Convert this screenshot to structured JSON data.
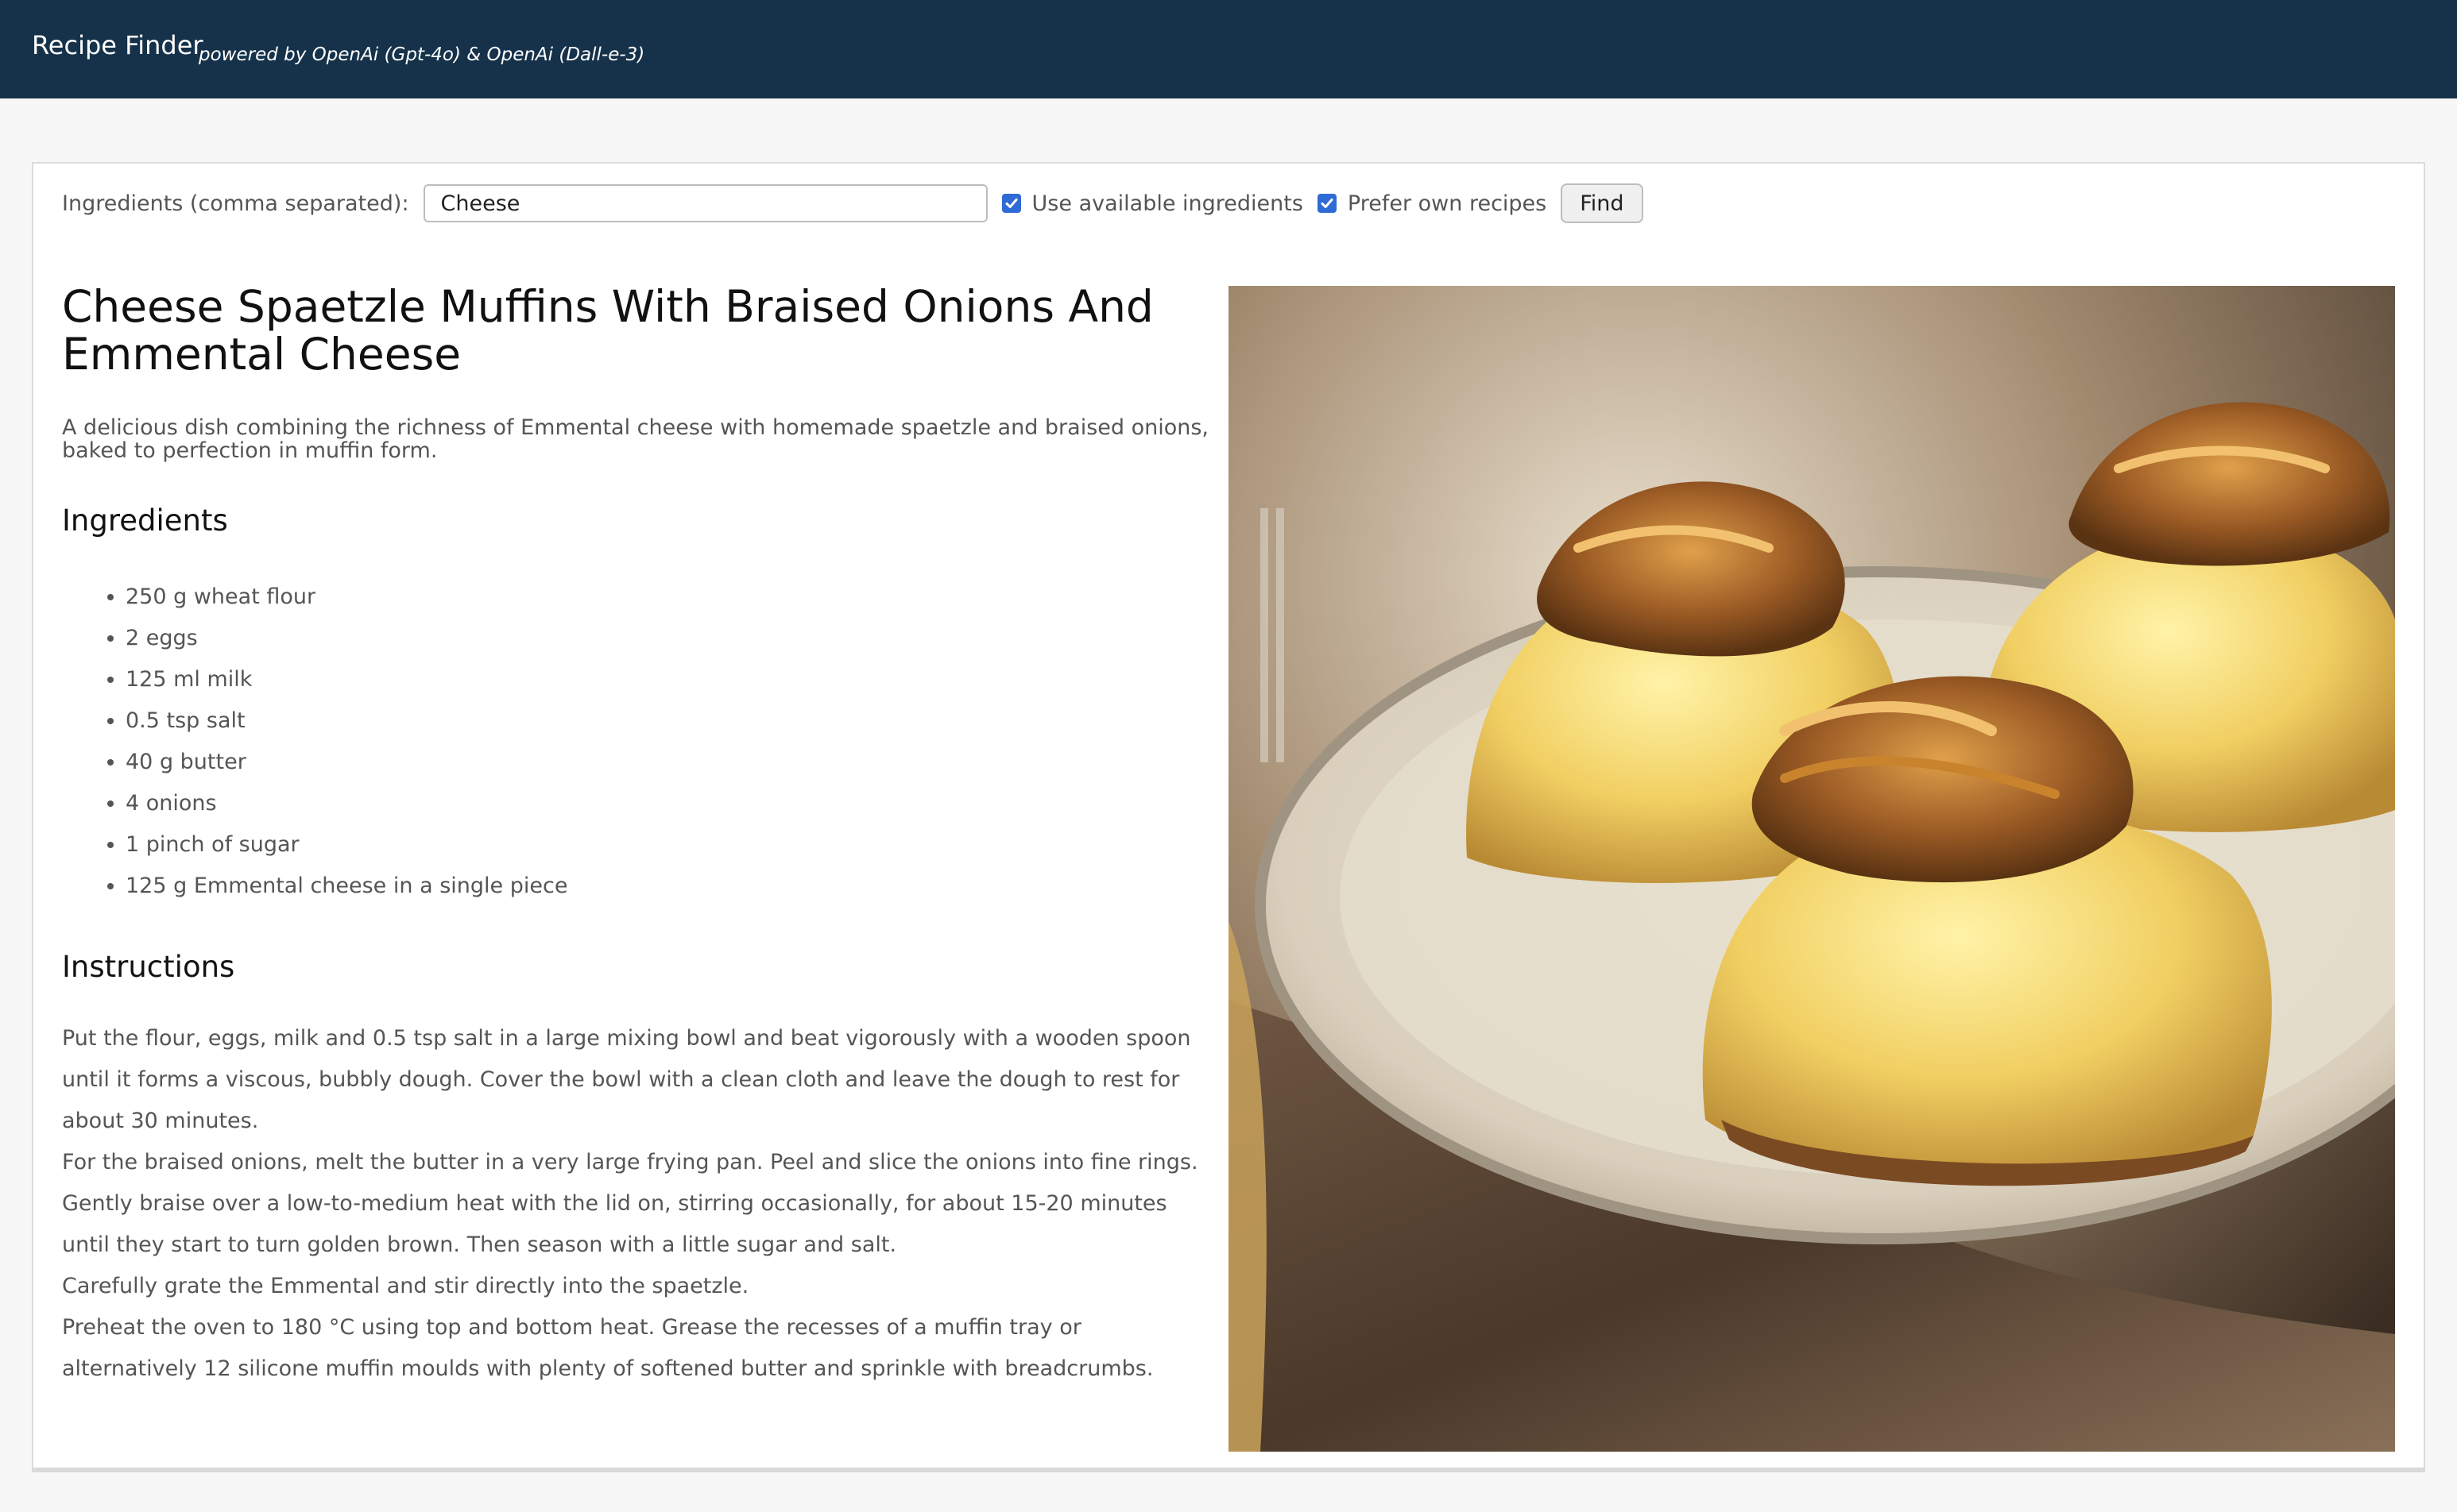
{
  "app": {
    "title": "Recipe Finder",
    "powered_by": "powered by OpenAi (Gpt-4o) & OpenAi (Dall-e-3)"
  },
  "search": {
    "label": "Ingredients (comma separated):",
    "value": "Cheese",
    "use_available_label": "Use available ingredients",
    "use_available_checked": true,
    "prefer_own_label": "Prefer own recipes",
    "prefer_own_checked": true,
    "find_label": "Find"
  },
  "recipe": {
    "title": "Cheese Spaetzle Muffins With Braised Onions And Emmental Cheese",
    "description": "A delicious dish combining the richness of Emmental cheese with homemade spaetzle and braised onions, baked to perfection in muffin form.",
    "ingredients_heading": "Ingredients",
    "ingredients": [
      "250 g wheat flour",
      "2 eggs",
      "125 ml milk",
      "0.5 tsp salt",
      "40 g butter",
      "4 onions",
      "1 pinch of sugar",
      "125 g Emmental cheese in a single piece"
    ],
    "instructions_heading": "Instructions",
    "instructions": [
      "Put the flour, eggs, milk and 0.5 tsp salt in a large mixing bowl and beat vigorously with a wooden spoon until it forms a viscous, bubbly dough. Cover the bowl with a clean cloth and leave the dough to rest for about 30 minutes.",
      "For the braised onions, melt the butter in a very large frying pan. Peel and slice the onions into fine rings. Gently braise over a low-to-medium heat with the lid on, stirring occasionally, for about 15-20 minutes until they start to turn golden brown. Then season with a little sugar and salt.",
      "Carefully grate the Emmental and stir directly into the spaetzle.",
      "Preheat the oven to 180 °C using top and bottom heat. Grease the recesses of a muffin tray or alternatively 12 silicone muffin moulds with plenty of softened butter and sprinkle with breadcrumbs."
    ],
    "image_subject": "cheese-spaetzle-muffins-photo"
  },
  "colors": {
    "navbar": "#15324a",
    "checkbox": "#2f6bd6"
  }
}
